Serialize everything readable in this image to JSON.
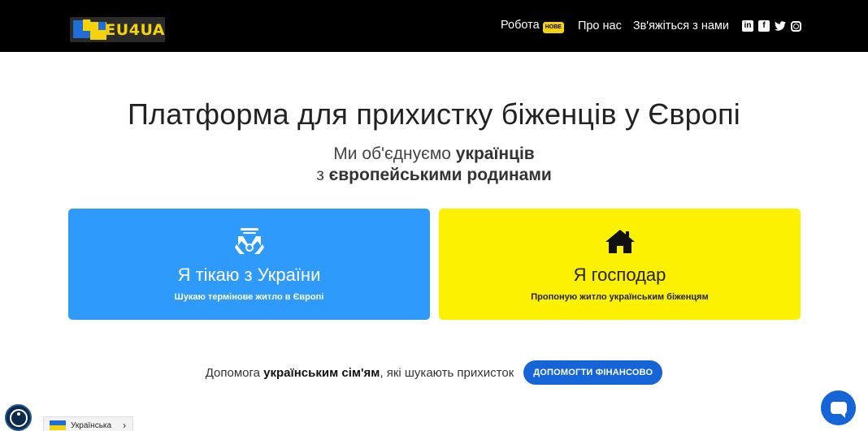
{
  "header": {
    "logo_text": "EU4UA",
    "nav": [
      {
        "label": "Робота",
        "badge": "НОВЕ"
      },
      {
        "label": "Про нас"
      },
      {
        "label": "Зв'яжіться з нами"
      }
    ],
    "social": {
      "linkedin": "in",
      "facebook": "f",
      "twitter": "🐦"
    }
  },
  "hero": {
    "title": "Платформа для прихистку біженців у Європі",
    "subtitle_line1_pre": "Ми об'єднуємо ",
    "subtitle_line1_bold": "українців",
    "subtitle_line2_pre": "з ",
    "subtitle_line2_bold": "європейськими родинами"
  },
  "cards": {
    "refugee": {
      "title": "Я тікаю з України",
      "desc": "Шукаю термінове житло в Європі",
      "icon": "hands-icon"
    },
    "host": {
      "title": "Я господар",
      "desc": "Пропоную житло українським біженцям",
      "icon": "house-icon"
    }
  },
  "help": {
    "text_pre": "Допомога ",
    "text_bold": "українським сім'ям",
    "text_post": ", які шукають прихисток",
    "button": "ДОПОМОГТИ ФІНАНСОВО"
  },
  "language": {
    "label": "Українська",
    "arrow": "›"
  },
  "colors": {
    "header_bg": "#000000",
    "brand_yellow": "#f6d20a",
    "card_blue": "#2e9afc",
    "card_yellow": "#fcf200",
    "button_blue": "#1565d8"
  }
}
